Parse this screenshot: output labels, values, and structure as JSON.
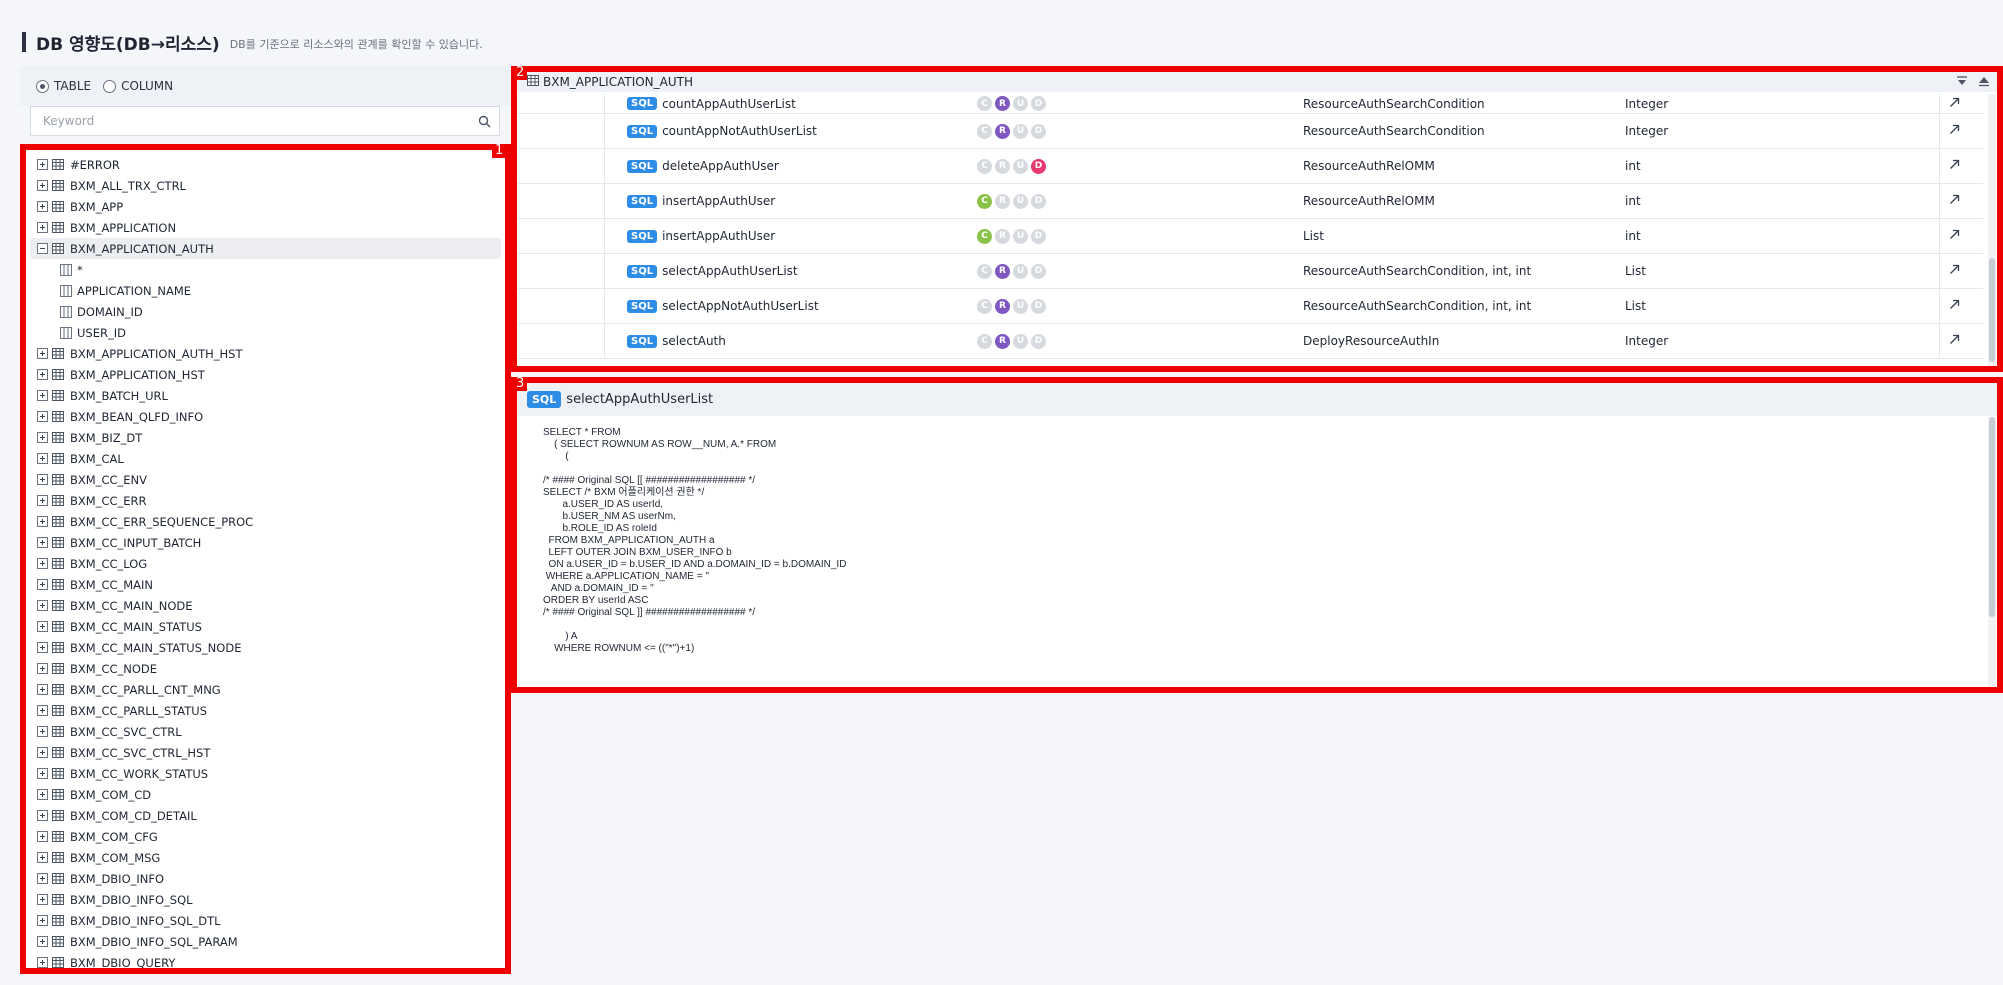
{
  "header": {
    "title": "DB 영향도(DB→리소스)",
    "description": "DB를 기준으로 리소스와의 관계를 확인할 수 있습니다."
  },
  "scope": {
    "options": [
      {
        "label": "TABLE",
        "selected": true
      },
      {
        "label": "COLUMN",
        "selected": false
      }
    ]
  },
  "search": {
    "placeholder": "Keyword",
    "value": ""
  },
  "panel_badges": [
    "1",
    "2",
    "3"
  ],
  "tree": {
    "items": [
      {
        "label": "#ERROR",
        "type": "table",
        "expanded": false
      },
      {
        "label": "BXM_ALL_TRX_CTRL",
        "type": "table",
        "expanded": false
      },
      {
        "label": "BXM_APP",
        "type": "table",
        "expanded": false
      },
      {
        "label": "BXM_APPLICATION",
        "type": "table",
        "expanded": false
      },
      {
        "label": "BXM_APPLICATION_AUTH",
        "type": "table",
        "expanded": true,
        "selected": true
      },
      {
        "label": "*",
        "type": "column"
      },
      {
        "label": "APPLICATION_NAME",
        "type": "column"
      },
      {
        "label": "DOMAIN_ID",
        "type": "column"
      },
      {
        "label": "USER_ID",
        "type": "column"
      },
      {
        "label": "BXM_APPLICATION_AUTH_HST",
        "type": "table",
        "expanded": false
      },
      {
        "label": "BXM_APPLICATION_HST",
        "type": "table",
        "expanded": false
      },
      {
        "label": "BXM_BATCH_URL",
        "type": "table",
        "expanded": false
      },
      {
        "label": "BXM_BEAN_QLFD_INFO",
        "type": "table",
        "expanded": false
      },
      {
        "label": "BXM_BIZ_DT",
        "type": "table",
        "expanded": false
      },
      {
        "label": "BXM_CAL",
        "type": "table",
        "expanded": false
      },
      {
        "label": "BXM_CC_ENV",
        "type": "table",
        "expanded": false
      },
      {
        "label": "BXM_CC_ERR",
        "type": "table",
        "expanded": false
      },
      {
        "label": "BXM_CC_ERR_SEQUENCE_PROC",
        "type": "table",
        "expanded": false
      },
      {
        "label": "BXM_CC_INPUT_BATCH",
        "type": "table",
        "expanded": false
      },
      {
        "label": "BXM_CC_LOG",
        "type": "table",
        "expanded": false
      },
      {
        "label": "BXM_CC_MAIN",
        "type": "table",
        "expanded": false
      },
      {
        "label": "BXM_CC_MAIN_NODE",
        "type": "table",
        "expanded": false
      },
      {
        "label": "BXM_CC_MAIN_STATUS",
        "type": "table",
        "expanded": false
      },
      {
        "label": "BXM_CC_MAIN_STATUS_NODE",
        "type": "table",
        "expanded": false
      },
      {
        "label": "BXM_CC_NODE",
        "type": "table",
        "expanded": false
      },
      {
        "label": "BXM_CC_PARLL_CNT_MNG",
        "type": "table",
        "expanded": false
      },
      {
        "label": "BXM_CC_PARLL_STATUS",
        "type": "table",
        "expanded": false
      },
      {
        "label": "BXM_CC_SVC_CTRL",
        "type": "table",
        "expanded": false
      },
      {
        "label": "BXM_CC_SVC_CTRL_HST",
        "type": "table",
        "expanded": false
      },
      {
        "label": "BXM_CC_WORK_STATUS",
        "type": "table",
        "expanded": false
      },
      {
        "label": "BXM_COM_CD",
        "type": "table",
        "expanded": false
      },
      {
        "label": "BXM_COM_CD_DETAIL",
        "type": "table",
        "expanded": false
      },
      {
        "label": "BXM_COM_CFG",
        "type": "table",
        "expanded": false
      },
      {
        "label": "BXM_COM_MSG",
        "type": "table",
        "expanded": false
      },
      {
        "label": "BXM_DBIO_INFO",
        "type": "table",
        "expanded": false
      },
      {
        "label": "BXM_DBIO_INFO_SQL",
        "type": "table",
        "expanded": false
      },
      {
        "label": "BXM_DBIO_INFO_SQL_DTL",
        "type": "table",
        "expanded": false
      },
      {
        "label": "BXM_DBIO_INFO_SQL_PARAM",
        "type": "table",
        "expanded": false
      },
      {
        "label": "BXM_DBIO_QUERY",
        "type": "table",
        "expanded": false
      }
    ]
  },
  "resource_panel": {
    "title": "BXM_APPLICATION_AUTH",
    "sql_tag": "SQL",
    "crud_letters": [
      "C",
      "R",
      "U",
      "D"
    ],
    "rows": [
      {
        "name": "countAppAuthUserList",
        "crud": [
          false,
          true,
          false,
          false
        ],
        "param": "ResourceAuthSearchCondition",
        "ret": "Integer"
      },
      {
        "name": "countAppNotAuthUserList",
        "crud": [
          false,
          true,
          false,
          false
        ],
        "param": "ResourceAuthSearchCondition",
        "ret": "Integer"
      },
      {
        "name": "deleteAppAuthUser",
        "crud": [
          false,
          false,
          false,
          true
        ],
        "param": "ResourceAuthRelOMM",
        "ret": "int"
      },
      {
        "name": "insertAppAuthUser",
        "crud": [
          true,
          false,
          false,
          false
        ],
        "param": "ResourceAuthRelOMM",
        "ret": "int"
      },
      {
        "name": "insertAppAuthUser",
        "crud": [
          true,
          false,
          false,
          false
        ],
        "param": "List",
        "ret": "int"
      },
      {
        "name": "selectAppAuthUserList",
        "crud": [
          false,
          true,
          false,
          false
        ],
        "param": "ResourceAuthSearchCondition, int, int",
        "ret": "List"
      },
      {
        "name": "selectAppNotAuthUserList",
        "crud": [
          false,
          true,
          false,
          false
        ],
        "param": "ResourceAuthSearchCondition, int, int",
        "ret": "List"
      },
      {
        "name": "selectAuth",
        "crud": [
          false,
          true,
          false,
          false
        ],
        "param": "DeployResourceAuthIn",
        "ret": "Integer"
      }
    ]
  },
  "sql_panel": {
    "tag": "SQL",
    "title": "selectAppAuthUserList",
    "code": "SELECT * FROM\n    ( SELECT ROWNUM AS ROW__NUM, A.* FROM\n        (\n\n/* #### Original SQL [[ ################## */\nSELECT /* BXM 어플리케이션 권한 */\n       a.USER_ID AS userId,\n       b.USER_NM AS userNm,\n       b.ROLE_ID AS roleId\n  FROM BXM_APPLICATION_AUTH a\n  LEFT OUTER JOIN BXM_USER_INFO b\n  ON a.USER_ID = b.USER_ID AND a.DOMAIN_ID = b.DOMAIN_ID\n WHERE a.APPLICATION_NAME = ''\n   AND a.DOMAIN_ID = ''\nORDER BY userId ASC\n/* #### Original SQL ]] ################## */\n\n        ) A\n    WHERE ROWNUM <= ((\"*\")+1)"
  },
  "colors": {
    "highlight_border": "#ee0000",
    "sql_tag": "#2d8ce6",
    "crud_c": "#8bc34a",
    "crud_r": "#7e57c2",
    "crud_d": "#e53970",
    "crud_off": "#d6d9de"
  }
}
